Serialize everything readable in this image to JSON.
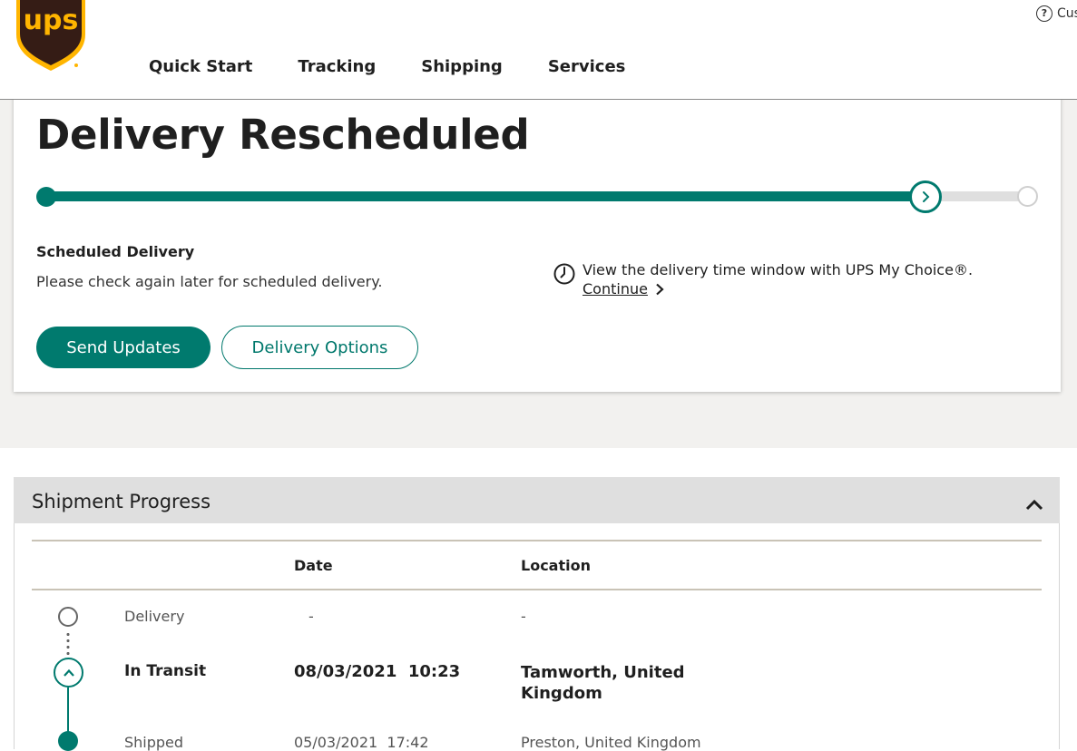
{
  "header": {
    "logo_text": "ups",
    "help_label": "Cus",
    "nav": [
      "Quick Start",
      "Tracking",
      "Shipping",
      "Services"
    ]
  },
  "status": {
    "title": "Delivery Rescheduled",
    "progress_fraction": 0.9,
    "scheduled_title": "Scheduled Delivery",
    "scheduled_text": "Please check again later for scheduled delivery.",
    "mychoice_text": "View the delivery time window with UPS My Choice®.",
    "continue_label": "Continue",
    "send_updates_label": "Send Updates",
    "delivery_options_label": "Delivery Options"
  },
  "progress": {
    "section_title": "Shipment Progress",
    "col_date": "Date",
    "col_location": "Location",
    "rows": [
      {
        "status": "Delivery",
        "date": "-",
        "location": "-"
      },
      {
        "status": "In Transit",
        "date": "08/03/2021  10:23",
        "location": "Tamworth, United Kingdom"
      },
      {
        "status": "Shipped",
        "date": "05/03/2021  17:42",
        "location": "Preston, United Kingdom"
      }
    ]
  },
  "colors": {
    "brand_teal": "#007a6e",
    "ups_brown": "#351c15",
    "ups_gold": "#ffb500"
  }
}
